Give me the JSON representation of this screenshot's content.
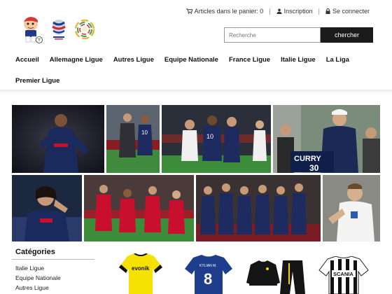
{
  "header": {
    "cart_label": "Articles dans le panier: 0",
    "signup_label": "Inscription",
    "login_label": "Se connecter"
  },
  "search": {
    "placeholder": "Recherche",
    "button_label": "chercher"
  },
  "nav": {
    "row1": [
      "Accueil",
      "Allemagne Ligue",
      "Autres Ligue",
      "Equipe Nationale",
      "France Ligue",
      "Italie Ligue",
      "La Liga"
    ],
    "row2": [
      "Premier Ligue"
    ]
  },
  "gallery": {
    "photo_4_jersey_text": "CURRY"
  },
  "categories": {
    "title": "Catégories",
    "items": [
      "Italie Ligue",
      "Equipe Nationale",
      "Autres Ligue"
    ]
  },
  "products": {
    "jersey_1_sponsor": "evonik",
    "jersey_2_name": "KYLIAN M.",
    "jersey_2_number": "8",
    "jersey_4_sponsor": "SCANIA"
  },
  "icons": [
    "cart-icon",
    "user-icon",
    "lock-icon"
  ]
}
